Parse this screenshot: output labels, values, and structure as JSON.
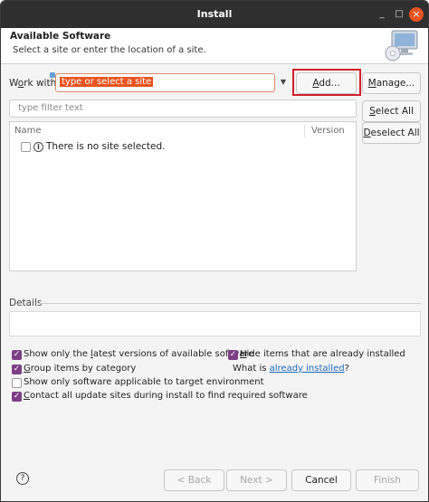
{
  "window": {
    "title": "Install",
    "controls": {
      "minimize": "_",
      "maximize": "□",
      "close": "×"
    }
  },
  "header": {
    "title": "Available Software",
    "description": "Select a site or enter the location of a site."
  },
  "work_with": {
    "label_pre": "W",
    "label_mnemonic": "o",
    "label_post": "rk with:",
    "input_value": "type or select a site",
    "dropdown_icon": "caret-down-icon"
  },
  "buttons": {
    "add": {
      "pre": "",
      "mnemonic": "A",
      "post": "dd..."
    },
    "manage": {
      "pre": "",
      "mnemonic": "M",
      "post": "anage..."
    },
    "select_all": {
      "pre": "",
      "mnemonic": "S",
      "post": "elect All"
    },
    "deselect_all": {
      "pre": "",
      "mnemonic": "D",
      "post": "eselect All"
    }
  },
  "filter": {
    "placeholder": "type filter text"
  },
  "table": {
    "columns": [
      "Name",
      "Version"
    ],
    "rows": [
      {
        "checked": false,
        "icon": "info-icon",
        "text": "There is no site selected."
      }
    ]
  },
  "details": {
    "label": "Details"
  },
  "options": {
    "latest": {
      "checked": true,
      "pre": "Show only the ",
      "mnemonic": "l",
      "post": "atest versions of available software"
    },
    "hide": {
      "checked": true,
      "pre": "",
      "mnemonic": "H",
      "post": "ide items that are already installed"
    },
    "group": {
      "checked": true,
      "pre": "",
      "mnemonic": "G",
      "post": "roup items by category"
    },
    "whatis": {
      "pre": "What is ",
      "link": "already installed",
      "post": "?"
    },
    "target": {
      "checked": false,
      "text": "Show only software applicable to target environment"
    },
    "contact": {
      "checked": true,
      "pre": "",
      "mnemonic": "C",
      "post": "ontact all update sites during install to find required software"
    }
  },
  "footer": {
    "help_icon": "help-icon",
    "back": "< Back",
    "next": "Next >",
    "cancel": "Cancel",
    "finish": "Finish"
  },
  "colors": {
    "accent": "#e95420",
    "checkbox_checked": "#7d3f86",
    "highlight_border": "#d0202a",
    "link": "#1e6ab5"
  }
}
